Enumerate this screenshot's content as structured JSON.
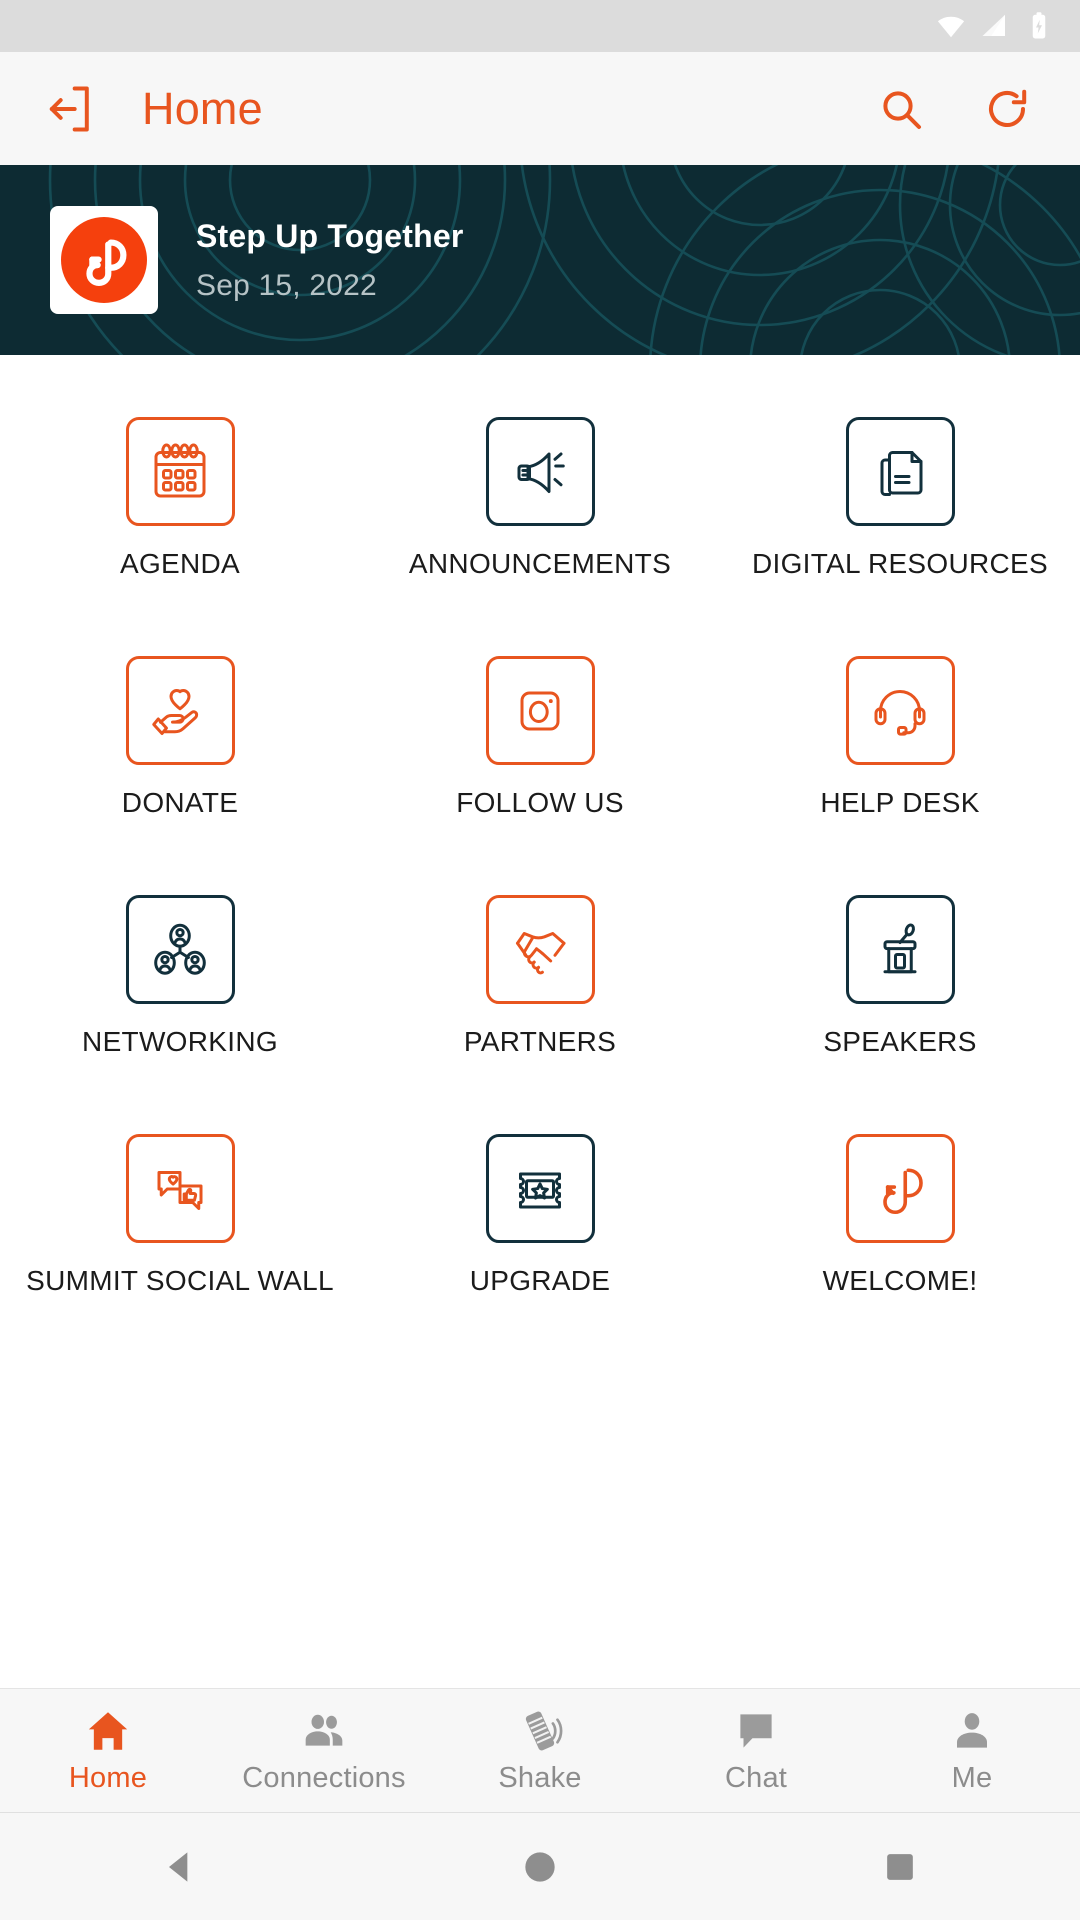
{
  "status_bar": {
    "icons": [
      "wifi-icon",
      "cellular-signal-icon",
      "battery-charging-icon"
    ]
  },
  "app_bar": {
    "exit_icon": "exit-icon",
    "title": "Home",
    "search_icon": "search-icon",
    "refresh_icon": "refresh-icon",
    "accent_color": "#e8551f"
  },
  "banner": {
    "logo_icon": "app-logo-icon",
    "event_title": "Step Up Together",
    "event_date": "Sep 15, 2022",
    "background_color": "#0d2b33"
  },
  "grid": {
    "orange": "#e8551f",
    "dark": "#12303c",
    "tiles": [
      {
        "label": "AGENDA",
        "icon": "calendar-icon",
        "color": "orange"
      },
      {
        "label": "ANNOUNCEMENTS",
        "icon": "megaphone-icon",
        "color": "dark"
      },
      {
        "label": "DIGITAL RESOURCES",
        "icon": "documents-icon",
        "color": "dark"
      },
      {
        "label": "DONATE",
        "icon": "hand-heart-icon",
        "color": "orange"
      },
      {
        "label": "FOLLOW US",
        "icon": "camera-icon",
        "color": "orange"
      },
      {
        "label": "HELP DESK",
        "icon": "headset-icon",
        "color": "orange"
      },
      {
        "label": "NETWORKING",
        "icon": "org-chart-icon",
        "color": "dark"
      },
      {
        "label": "PARTNERS",
        "icon": "handshake-icon",
        "color": "orange"
      },
      {
        "label": "SPEAKERS",
        "icon": "podium-icon",
        "color": "dark"
      },
      {
        "label": "SUMMIT SOCIAL WALL",
        "icon": "chat-bubbles-icon",
        "color": "orange"
      },
      {
        "label": "UPGRADE",
        "icon": "ticket-star-icon",
        "color": "dark"
      },
      {
        "label": "WELCOME!",
        "icon": "app-logo-mark-icon",
        "color": "orange"
      }
    ]
  },
  "bottom_nav": {
    "active_color": "#e8551f",
    "inactive_color": "#8c8c8c",
    "items": [
      {
        "label": "Home",
        "icon": "home-icon",
        "active": true
      },
      {
        "label": "Connections",
        "icon": "people-icon",
        "active": false
      },
      {
        "label": "Shake",
        "icon": "shake-phone-icon",
        "active": false
      },
      {
        "label": "Chat",
        "icon": "chat-icon",
        "active": false
      },
      {
        "label": "Me",
        "icon": "person-icon",
        "active": false
      }
    ]
  },
  "system_nav": {
    "back": "back-triangle-icon",
    "home": "home-circle-icon",
    "recents": "recents-square-icon"
  }
}
